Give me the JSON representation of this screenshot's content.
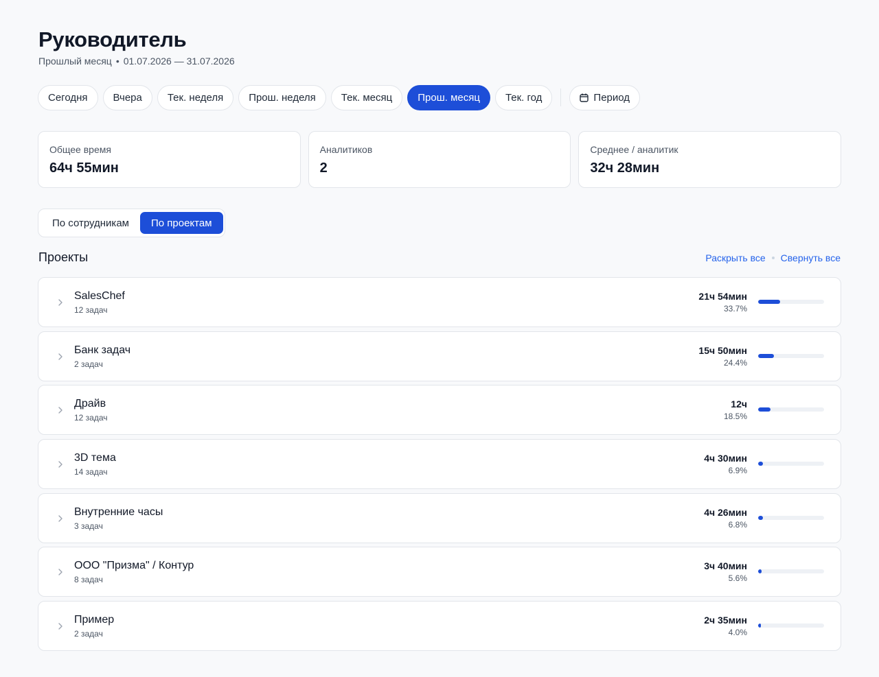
{
  "header": {
    "title": "Руководитель",
    "period_name": "Прошлый месяц",
    "period_range": "01.07.2026 — 31.07.2026"
  },
  "filters": {
    "chips": [
      {
        "label": "Сегодня",
        "active": false
      },
      {
        "label": "Вчера",
        "active": false
      },
      {
        "label": "Тек. неделя",
        "active": false
      },
      {
        "label": "Прош. неделя",
        "active": false
      },
      {
        "label": "Тек. месяц",
        "active": false
      },
      {
        "label": "Прош. месяц",
        "active": true
      },
      {
        "label": "Тек. год",
        "active": false
      }
    ],
    "period_label": "Период",
    "period_icon": "calendar-icon"
  },
  "stats": [
    {
      "label": "Общее время",
      "value": "64ч 55мин"
    },
    {
      "label": "Аналитиков",
      "value": "2"
    },
    {
      "label": "Среднее / аналитик",
      "value": "32ч 28мин"
    }
  ],
  "view_toggle": {
    "by_employees": "По сотрудникам",
    "by_projects": "По проектам",
    "active": "by_projects"
  },
  "projects_section": {
    "title": "Проекты",
    "expand_all": "Раскрыть все",
    "collapse_all": "Свернуть все"
  },
  "projects": [
    {
      "name": "SalesChef",
      "tasks": "12 задач",
      "time": "21ч 54мин",
      "percent": "33.7%",
      "share": 0.337
    },
    {
      "name": "Банк задач",
      "tasks": "2 задач",
      "time": "15ч 50мин",
      "percent": "24.4%",
      "share": 0.244
    },
    {
      "name": "Драйв",
      "tasks": "12 задач",
      "time": "12ч",
      "percent": "18.5%",
      "share": 0.185
    },
    {
      "name": "3D тема",
      "tasks": "14 задач",
      "time": "4ч 30мин",
      "percent": "6.9%",
      "share": 0.069
    },
    {
      "name": "Внутренние часы",
      "tasks": "3 задач",
      "time": "4ч 26мин",
      "percent": "6.8%",
      "share": 0.068
    },
    {
      "name": "ООО \"Призма\" / Контур",
      "tasks": "8 задач",
      "time": "3ч 40мин",
      "percent": "5.6%",
      "share": 0.056
    },
    {
      "name": "Пример",
      "tasks": "2 задач",
      "time": "2ч 35мин",
      "percent": "4.0%",
      "share": 0.04
    }
  ],
  "colors": {
    "accent": "#1d4ed8",
    "link": "#2563eb",
    "border": "#e2e5ea",
    "background": "#f8f9fb"
  }
}
